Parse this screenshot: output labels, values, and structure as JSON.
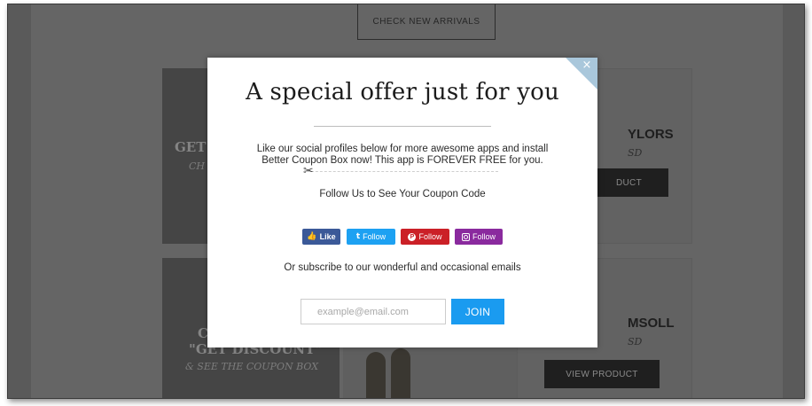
{
  "background": {
    "arrivals_button": "CHECK NEW ARRIVALS",
    "promo_top": {
      "title": "GET",
      "subtitle": "CH"
    },
    "promo_bottom": {
      "title_1": "CL",
      "title_2": "\"GET DISCOUNT\"",
      "subtitle": "& SEE THE COUPON BOX"
    },
    "products": [
      {
        "name": "YLORS",
        "price": "SD",
        "button": "DUCT"
      },
      {
        "name": "MSOLL",
        "price": "SD",
        "button": "VIEW PRODUCT"
      }
    ]
  },
  "modal": {
    "close_icon": "×",
    "title": "A special offer just for you",
    "description": "Like our social profiles below for more awesome apps and install Better Coupon Box now! This app is FOREVER FREE for you.",
    "scissors_icon": "✂",
    "follow_prompt": "Follow Us to See Your Coupon Code",
    "social": {
      "facebook": {
        "icon": "👍",
        "label": "Like"
      },
      "twitter": {
        "icon": "t",
        "label": "Follow"
      },
      "pinterest": {
        "icon": "P",
        "label": "Follow"
      },
      "instagram": {
        "label": "Follow"
      }
    },
    "subscribe_prompt": "Or subscribe to our wonderful and occasional emails",
    "email": {
      "placeholder": "example@email.com",
      "value": ""
    },
    "join_label": "JOIN"
  },
  "colors": {
    "overlay": "#656565",
    "join": "#1a9bf0",
    "facebook": "#3b5998",
    "twitter": "#1da1f2",
    "pinterest": "#cb2027",
    "instagram": "#8a2a9e",
    "close_corner": "#a9c7db"
  }
}
